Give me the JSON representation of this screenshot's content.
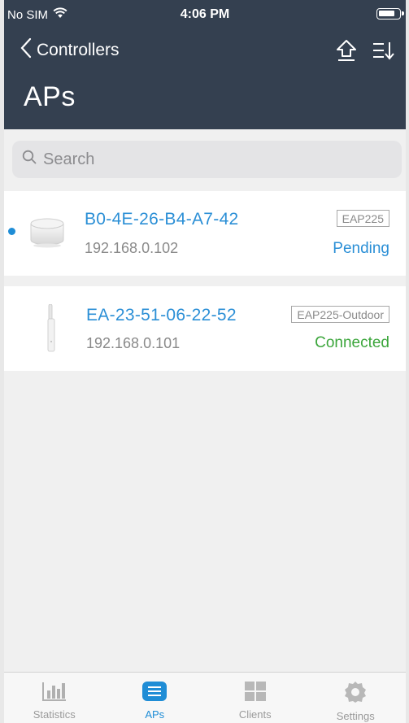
{
  "status_bar": {
    "carrier": "No SIM",
    "time": "4:06 PM"
  },
  "nav": {
    "back_label": "Controllers",
    "title": "APs"
  },
  "search": {
    "placeholder": "Search"
  },
  "devices": [
    {
      "mac": "B0-4E-26-B4-A7-42",
      "ip": "192.168.0.102",
      "model": "EAP225",
      "status": "Pending",
      "status_color": "#2b8fd6",
      "icon": "ceiling-ap-icon"
    },
    {
      "mac": "EA-23-51-06-22-52",
      "ip": "192.168.0.101",
      "model": "EAP225-Outdoor",
      "status": "Connected",
      "status_color": "#3ca63c",
      "icon": "outdoor-ap-icon"
    }
  ],
  "tabs": [
    {
      "label": "Statistics",
      "icon": "bar-chart-icon"
    },
    {
      "label": "APs",
      "icon": "list-icon",
      "active": true
    },
    {
      "label": "Clients",
      "icon": "grid-icon"
    },
    {
      "label": "Settings",
      "icon": "gear-icon"
    }
  ],
  "colors": {
    "header_bg": "#344050",
    "accent": "#1f8dd6",
    "connected": "#3ca63c"
  }
}
